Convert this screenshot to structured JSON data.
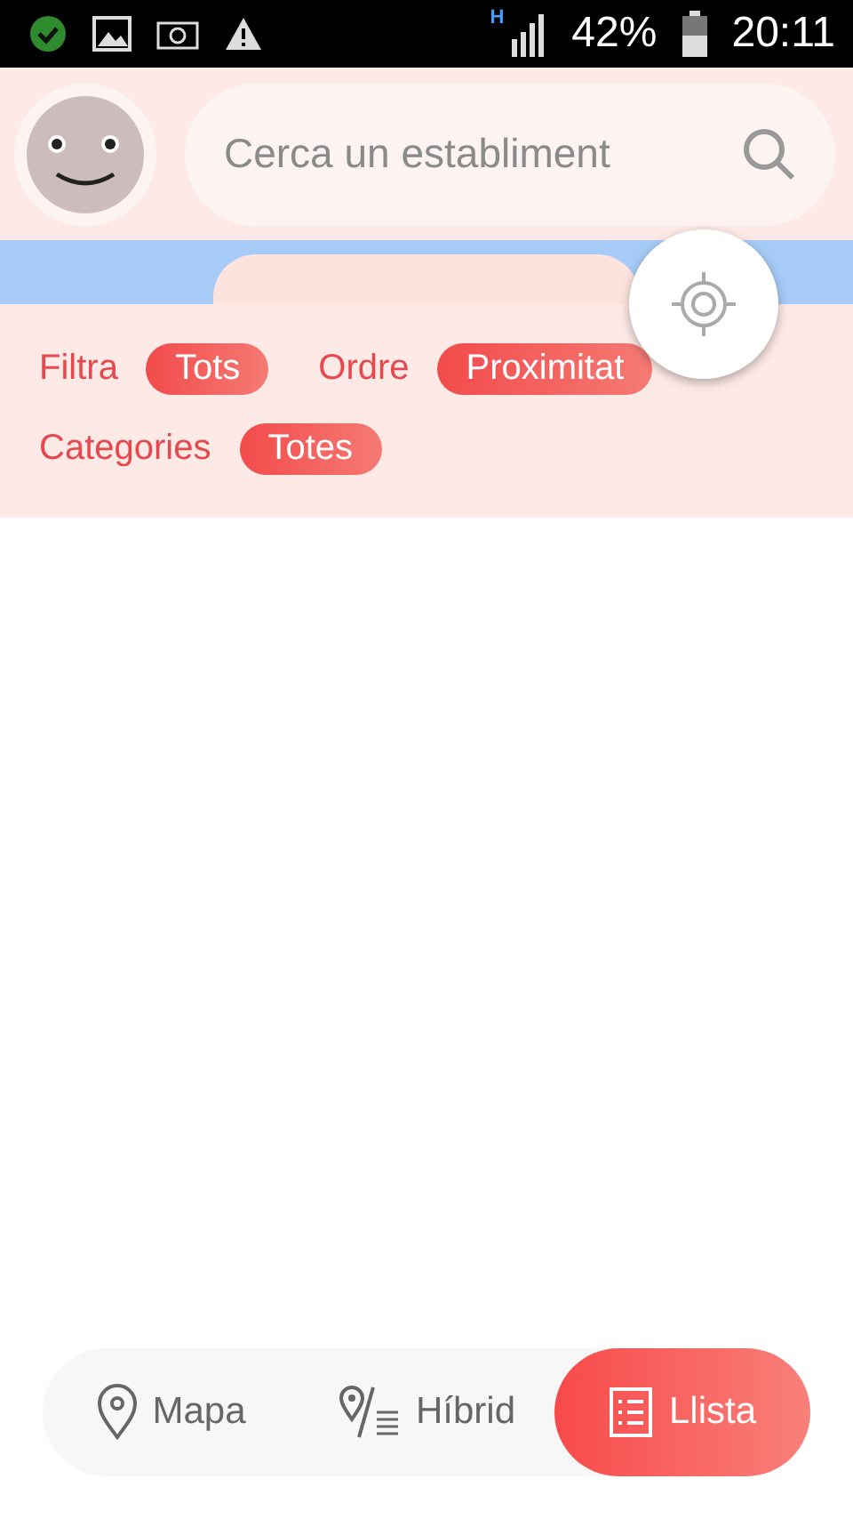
{
  "status_bar": {
    "network": "H",
    "battery": "42%",
    "time": "20:11"
  },
  "search": {
    "placeholder": "Cerca un establiment"
  },
  "filters": [
    {
      "label": "Filtra",
      "value": "Tots"
    },
    {
      "label": "Ordre",
      "value": "Proximitat"
    },
    {
      "label": "Categories",
      "value": "Totes"
    }
  ],
  "view_tabs": [
    {
      "label": "Mapa",
      "kind": "map",
      "selected": false
    },
    {
      "label": "Híbrid",
      "kind": "hybrid",
      "selected": false
    },
    {
      "label": "Llista",
      "kind": "list",
      "selected": true
    }
  ]
}
